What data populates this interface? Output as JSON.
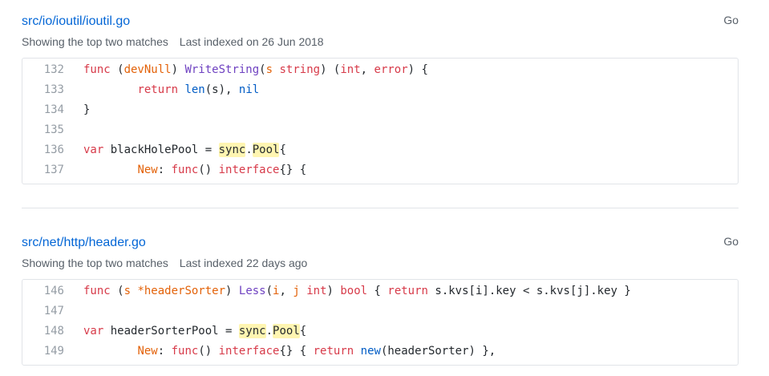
{
  "results": [
    {
      "path": "src/io/ioutil/ioutil.go",
      "language": "Go",
      "matches_label": "Showing the top two matches",
      "indexed_label": "Last indexed on 26 Jun 2018",
      "lines": [
        {
          "num": "132",
          "segments": [
            {
              "t": "func",
              "c": "kw"
            },
            {
              "t": " ("
            },
            {
              "t": "devNull",
              "c": "ty"
            },
            {
              "t": ") "
            },
            {
              "t": "WriteString",
              "c": "fn"
            },
            {
              "t": "("
            },
            {
              "t": "s",
              "c": "ty"
            },
            {
              "t": " "
            },
            {
              "t": "string",
              "c": "kw"
            },
            {
              "t": ") ("
            },
            {
              "t": "int",
              "c": "kw"
            },
            {
              "t": ", "
            },
            {
              "t": "error",
              "c": "kw"
            },
            {
              "t": ") {"
            }
          ]
        },
        {
          "num": "133",
          "segments": [
            {
              "t": "        "
            },
            {
              "t": "return",
              "c": "kw"
            },
            {
              "t": " "
            },
            {
              "t": "len",
              "c": "bl"
            },
            {
              "t": "(s), "
            },
            {
              "t": "nil",
              "c": "bl"
            }
          ]
        },
        {
          "num": "134",
          "segments": [
            {
              "t": "}"
            }
          ]
        },
        {
          "num": "135",
          "segments": [
            {
              "t": ""
            }
          ]
        },
        {
          "num": "136",
          "segments": [
            {
              "t": "var",
              "c": "kw"
            },
            {
              "t": " blackHolePool = "
            },
            {
              "t": "sync",
              "c": "hl"
            },
            {
              "t": "."
            },
            {
              "t": "Pool",
              "c": "hl"
            },
            {
              "t": "{"
            }
          ]
        },
        {
          "num": "137",
          "segments": [
            {
              "t": "        "
            },
            {
              "t": "New",
              "c": "ty"
            },
            {
              "t": ": "
            },
            {
              "t": "func",
              "c": "kw"
            },
            {
              "t": "() "
            },
            {
              "t": "interface",
              "c": "kw"
            },
            {
              "t": "{} {"
            }
          ]
        }
      ]
    },
    {
      "path": "src/net/http/header.go",
      "language": "Go",
      "matches_label": "Showing the top two matches",
      "indexed_label": "Last indexed 22 days ago",
      "lines": [
        {
          "num": "146",
          "segments": [
            {
              "t": "func",
              "c": "kw"
            },
            {
              "t": " ("
            },
            {
              "t": "s",
              "c": "ty"
            },
            {
              "t": " "
            },
            {
              "t": "*headerSorter",
              "c": "ty"
            },
            {
              "t": ") "
            },
            {
              "t": "Less",
              "c": "fn"
            },
            {
              "t": "("
            },
            {
              "t": "i",
              "c": "ty"
            },
            {
              "t": ", "
            },
            {
              "t": "j",
              "c": "ty"
            },
            {
              "t": " "
            },
            {
              "t": "int",
              "c": "kw"
            },
            {
              "t": ") "
            },
            {
              "t": "bool",
              "c": "kw"
            },
            {
              "t": " { "
            },
            {
              "t": "return",
              "c": "kw"
            },
            {
              "t": " s.kvs[i].key < s.kvs[j].key }"
            }
          ]
        },
        {
          "num": "147",
          "segments": [
            {
              "t": ""
            }
          ]
        },
        {
          "num": "148",
          "segments": [
            {
              "t": "var",
              "c": "kw"
            },
            {
              "t": " headerSorterPool = "
            },
            {
              "t": "sync",
              "c": "hl"
            },
            {
              "t": "."
            },
            {
              "t": "Pool",
              "c": "hl"
            },
            {
              "t": "{"
            }
          ]
        },
        {
          "num": "149",
          "segments": [
            {
              "t": "        "
            },
            {
              "t": "New",
              "c": "ty"
            },
            {
              "t": ": "
            },
            {
              "t": "func",
              "c": "kw"
            },
            {
              "t": "() "
            },
            {
              "t": "interface",
              "c": "kw"
            },
            {
              "t": "{} { "
            },
            {
              "t": "return",
              "c": "kw"
            },
            {
              "t": " "
            },
            {
              "t": "new",
              "c": "bl"
            },
            {
              "t": "(headerSorter) },"
            }
          ]
        }
      ]
    }
  ]
}
